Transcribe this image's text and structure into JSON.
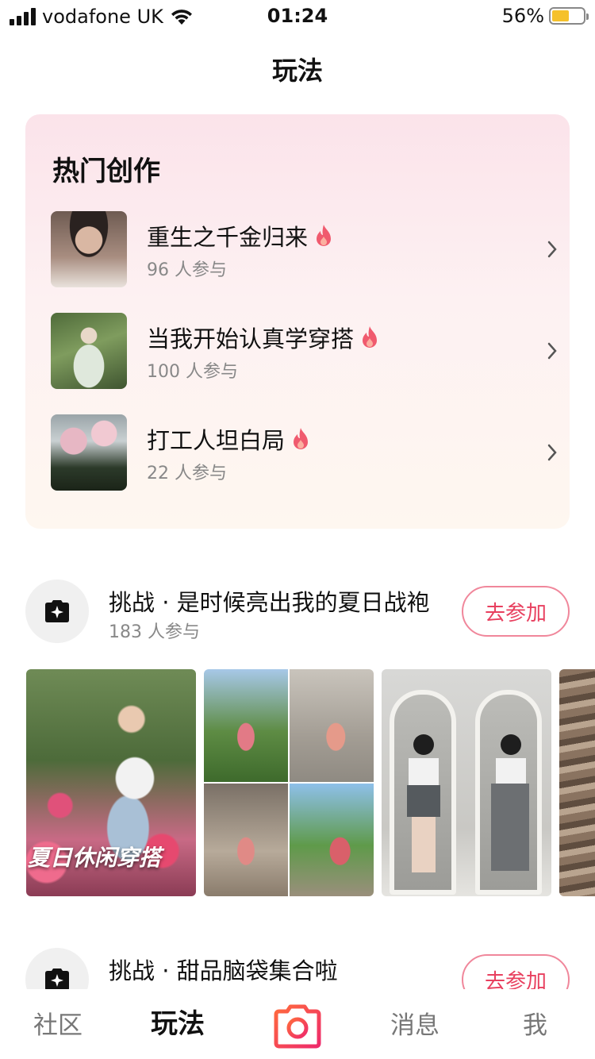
{
  "status_bar": {
    "carrier": "vodafone UK",
    "time": "01:24",
    "battery_percent": "56%",
    "battery_level": 0.56,
    "icons": [
      "signal-icon",
      "wifi-icon",
      "battery-icon"
    ]
  },
  "header": {
    "title": "玩法"
  },
  "hot_section": {
    "title": "热门创作",
    "items": [
      {
        "name": "重生之千金归来",
        "count": "96 人参与",
        "icon": "flame-icon"
      },
      {
        "name": "当我开始认真学穿搭",
        "count": "100 人参与",
        "icon": "flame-icon"
      },
      {
        "name": "打工人坦白局",
        "count": "22 人参与",
        "icon": "flame-icon"
      }
    ]
  },
  "challenges": [
    {
      "title": "挑战 · 是时候亮出我的夏日战袍",
      "count": "183 人参与",
      "join_label": "去参加",
      "gallery": [
        {
          "caption": "夏日休闲穿搭"
        },
        {
          "caption": ""
        },
        {
          "caption": ""
        },
        {
          "caption": ""
        }
      ]
    },
    {
      "title": "挑战 · 甜品脑袋集合啦",
      "count": "",
      "join_label": "去参加"
    }
  ],
  "tab_bar": {
    "tabs": [
      "社区",
      "玩法",
      "消息",
      "我"
    ],
    "active": "玩法",
    "accent_color": "#e8405f"
  }
}
